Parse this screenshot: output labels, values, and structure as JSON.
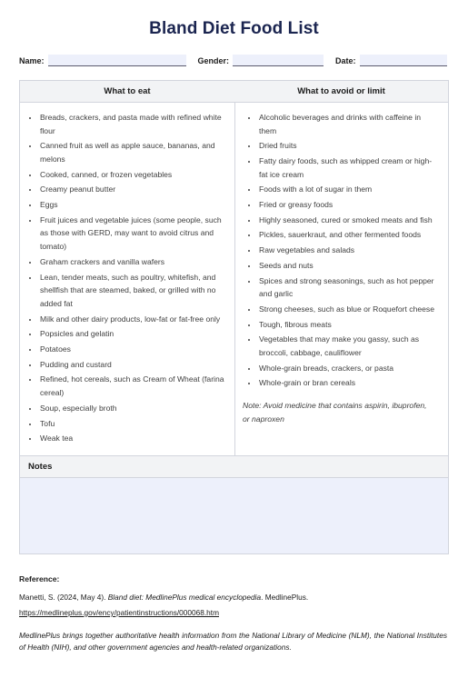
{
  "document": {
    "title": "Bland Diet Food List",
    "title_color": "#1b2550"
  },
  "form": {
    "fields": [
      {
        "label": "Name:",
        "value": "",
        "placeholder": ""
      },
      {
        "label": "Gender:",
        "value": "",
        "placeholder": ""
      },
      {
        "label": "Date:",
        "value": "",
        "placeholder": ""
      }
    ],
    "field_fill_color": "#edf0fb"
  },
  "table": {
    "headers": {
      "eat": "What to eat",
      "avoid": "What to avoid or limit"
    },
    "header_bg": "#f2f3f5",
    "border_color": "#d2d5dd",
    "eat_items": [
      "Breads, crackers, and pasta made with refined white flour",
      "Canned fruit as well as apple sauce, bananas, and melons",
      "Cooked, canned, or frozen vegetables",
      "Creamy peanut butter",
      "Eggs",
      "Fruit juices and vegetable juices (some people, such as those with GERD, may want to avoid citrus and tomato)",
      "Graham crackers and vanilla wafers",
      "Lean, tender meats, such as poultry, whitefish, and shellfish that are steamed, baked, or grilled with no added fat",
      "Milk and other dairy products, low-fat or fat-free only",
      "Popsicles and gelatin",
      "Potatoes",
      "Pudding and custard",
      "Refined, hot cereals, such as Cream of Wheat (farina cereal)",
      "Soup, especially broth",
      "Tofu",
      "Weak tea"
    ],
    "avoid_items": [
      "Alcoholic beverages and drinks with caffeine in them",
      "Dried fruits",
      "Fatty dairy foods, such as whipped cream or high-fat ice cream",
      "Foods with a lot of sugar in them",
      "Fried or greasy foods",
      "Highly seasoned, cured or smoked meats and fish",
      "Pickles, sauerkraut, and other fermented foods",
      "Raw vegetables and salads",
      "Seeds and nuts",
      "Spices and strong seasonings, such as hot pepper and garlic",
      "Strong cheeses, such as blue or Roquefort cheese",
      "Tough, fibrous meats",
      "Vegetables that may make you gassy, such as broccoli, cabbage, cauliflower",
      "Whole-grain breads, crackers, or pasta",
      "Whole-grain or bran cereals"
    ],
    "avoid_note": "Note: Avoid medicine that contains aspirin, ibuprofen, or naproxen"
  },
  "notes": {
    "heading": "Notes",
    "value": "",
    "body_fill_color": "#edf0fb"
  },
  "reference": {
    "heading": "Reference:",
    "citation_part1": "Manetti, S. (2024, May 4). ",
    "citation_italic": "Bland diet: MedlinePlus medical encyclopedia",
    "citation_part2": ". MedlinePlus.",
    "url": "https://medlineplus.gov/ency/patientinstructions/000068.htm",
    "blurb": "MedlinePlus brings together authoritative health information from the National Library of Medicine (NLM), the National Institutes of Health (NIH), and other government agencies and health-related organizations."
  }
}
